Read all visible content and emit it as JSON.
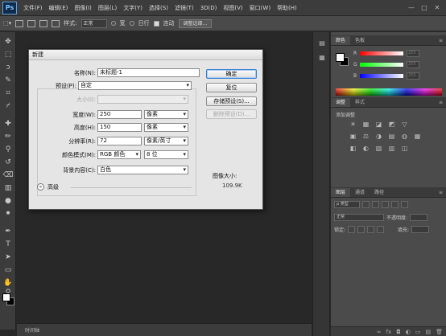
{
  "app": {
    "logo": "Ps"
  },
  "menu": [
    "文件(F)",
    "编辑(E)",
    "图像(I)",
    "图层(L)",
    "文字(Y)",
    "选择(S)",
    "滤镜(T)",
    "3D(D)",
    "视图(V)",
    "窗口(W)",
    "帮助(H)"
  ],
  "window_controls": {
    "minimize": "—",
    "restore": "□",
    "close": "✕"
  },
  "options_bar": {
    "style_label": "样式:",
    "style_value": "正常",
    "radio1_label": "宽",
    "radio2_label": "日行",
    "checkbox_label": "连动",
    "refine_button": "调整边缘..."
  },
  "status_bar": {
    "text": "时间轴"
  },
  "color_panel": {
    "tabs": [
      "颜色",
      "色板"
    ],
    "channels": [
      {
        "label": "R",
        "value": "255",
        "color_from": "#ff0000",
        "color_to": "#ffffff"
      },
      {
        "label": "G",
        "value": "255",
        "color_from": "#00ff00",
        "color_to": "#ffffff"
      },
      {
        "label": "B",
        "value": "255",
        "color_from": "#0000ff",
        "color_to": "#ffffff"
      }
    ]
  },
  "adjustments_panel": {
    "tabs": [
      "调整",
      "样式"
    ],
    "title": "添加调整",
    "icons": [
      "☀",
      "▦",
      "◪",
      "◩",
      "▽",
      "",
      "▣",
      "⚖",
      "◑",
      "▤",
      "◍",
      "▦",
      "◧",
      "◐",
      "▨",
      "▥",
      "◫",
      ""
    ]
  },
  "layers_panel": {
    "tabs": [
      "图层",
      "通道",
      "路径"
    ],
    "filter_label": "ρ 类型",
    "blend_mode": "正常",
    "opacity_label": "不透明度:",
    "lock_label": "锁定:",
    "fill_label": "填充:",
    "bottom_icons": [
      "∞",
      "fx",
      "◘",
      "◐",
      "▭",
      "▤",
      "🗑"
    ]
  },
  "dialog": {
    "title": "新建",
    "name_label": "名称(N):",
    "name_value": "未标题-1",
    "preset_label": "预设(P):",
    "preset_value": "自定",
    "size_label": "大小(I):",
    "size_value": "",
    "width_label": "宽度(W):",
    "width_value": "250",
    "width_unit": "像素",
    "height_label": "高度(H):",
    "height_value": "150",
    "height_unit": "像素",
    "resolution_label": "分辨率(R):",
    "resolution_value": "72",
    "resolution_unit": "像素/英寸",
    "color_mode_label": "颜色模式(M):",
    "color_mode_value": "RGB 颜色",
    "bit_depth_value": "8 位",
    "background_label": "背景内容(C):",
    "background_value": "白色",
    "advanced_label": "高级",
    "ok_button": "确定",
    "cancel_button": "复位",
    "save_preset_button": "存储预设(S)...",
    "delete_preset_button": "删除预设(D)...",
    "image_size_label": "图像大小:",
    "image_size_value": "109.9K"
  }
}
